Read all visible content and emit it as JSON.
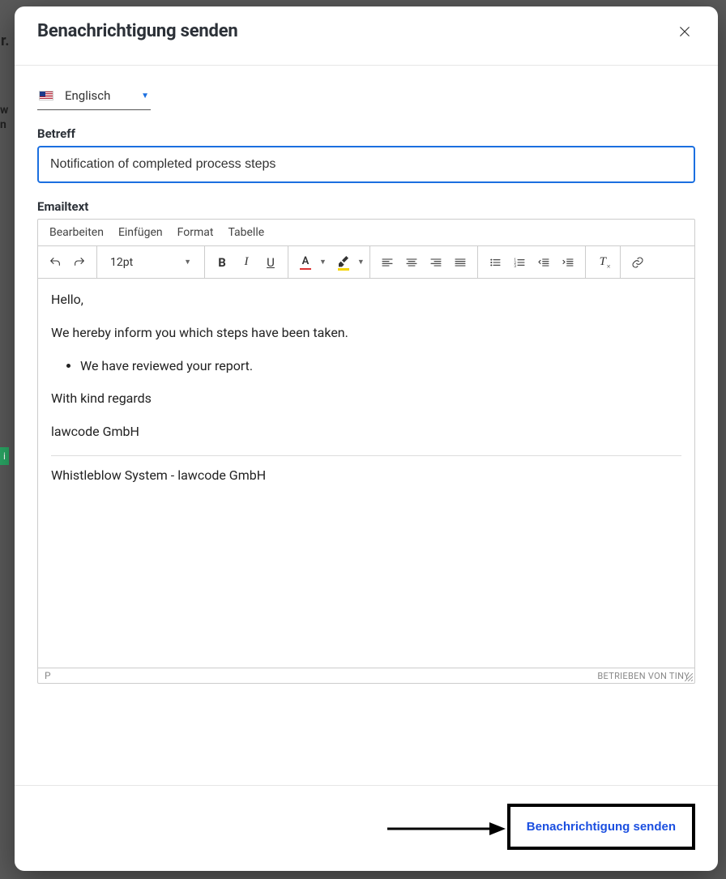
{
  "modal": {
    "title": "Benachrichtigung senden"
  },
  "language": {
    "label": "Englisch"
  },
  "subject": {
    "label": "Betreff",
    "value": "Notification of completed process steps"
  },
  "emailtext": {
    "label": "Emailtext"
  },
  "editor": {
    "menubar": {
      "edit": "Bearbeiten",
      "insert": "Einfügen",
      "format": "Format",
      "table": "Tabelle"
    },
    "font_size": "12pt",
    "content": {
      "greeting": "Hello,",
      "intro": "We hereby inform you which steps have been taken.",
      "bullet1": "We have reviewed your report.",
      "regards": "With kind regards",
      "company": "lawcode GmbH",
      "footer": "Whistleblow System - lawcode GmbH"
    },
    "status_path": "P",
    "powered_by": "BETRIEBEN VON TINY"
  },
  "footer": {
    "send_button": "Benachrichtigung senden"
  }
}
